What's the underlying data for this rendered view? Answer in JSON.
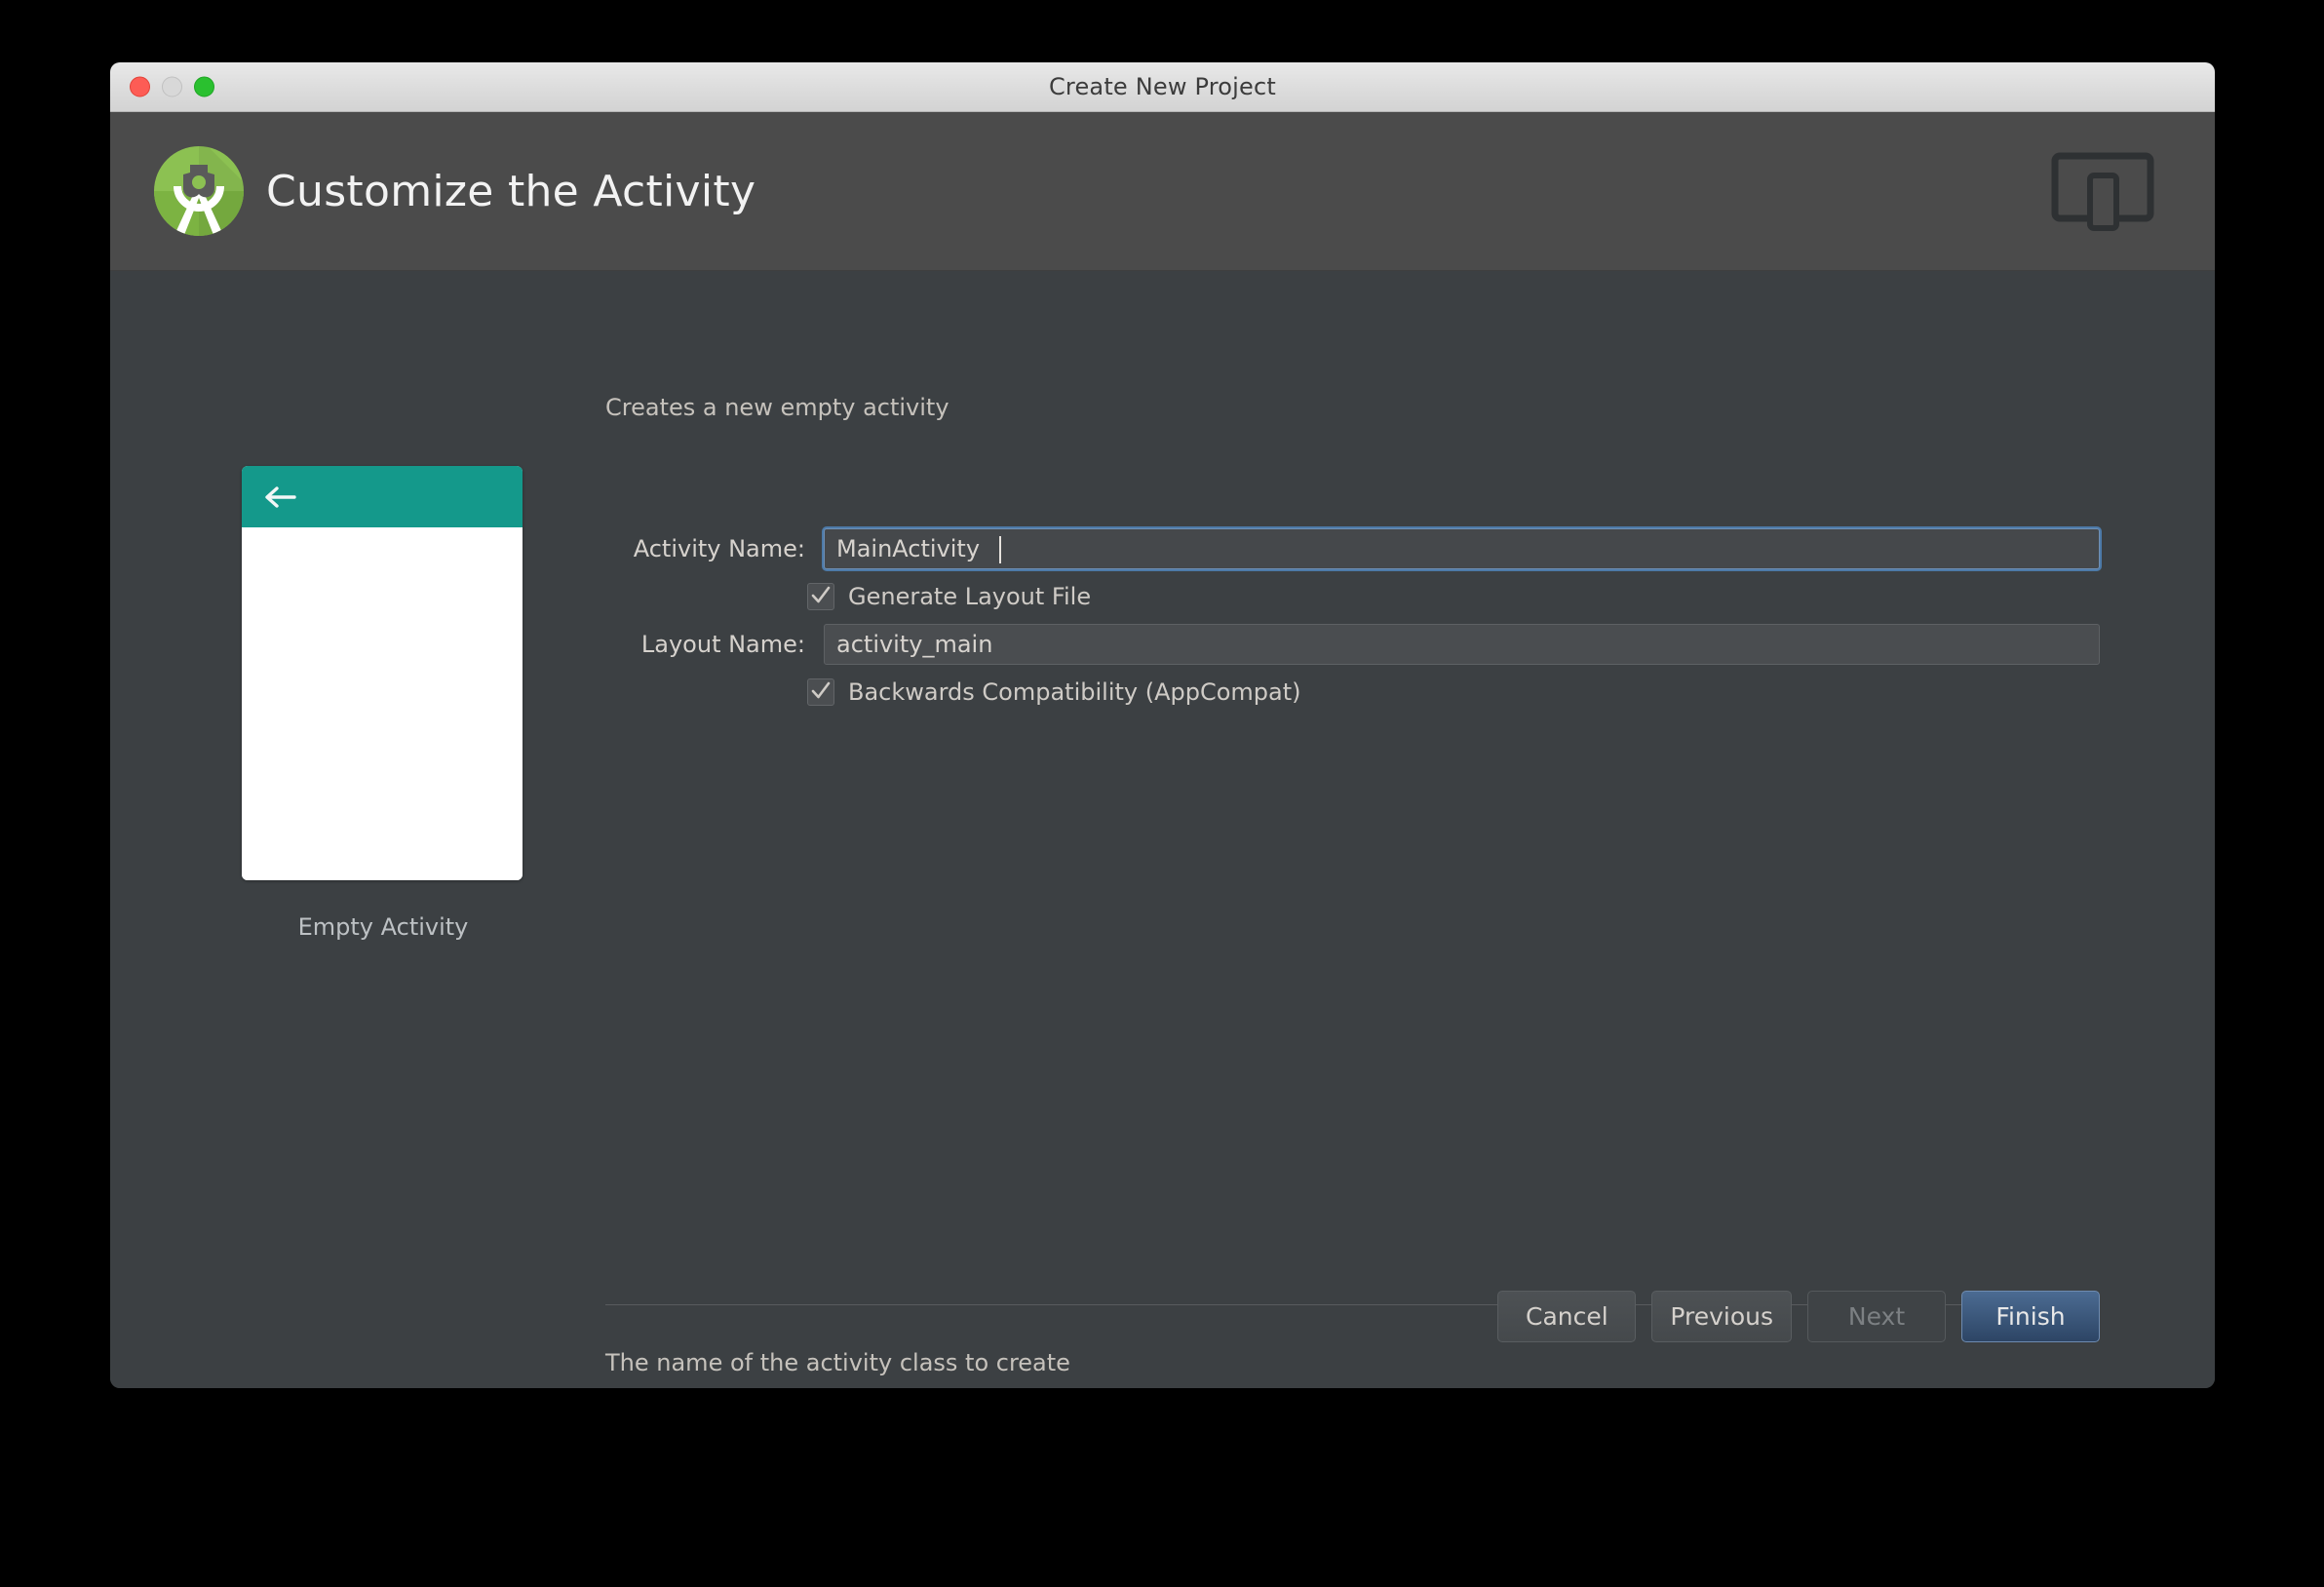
{
  "window": {
    "title": "Create New Project",
    "traffic_lights": [
      "close",
      "minimize",
      "zoom"
    ]
  },
  "header": {
    "title": "Customize the Activity",
    "logo_icon": "android-studio-logo-icon",
    "form_factor_icon": "device-form-factor-icon",
    "accent_green": "#8bc34a"
  },
  "preview": {
    "appbar_color": "#14998b",
    "back_icon": "back-arrow-icon",
    "caption": "Empty Activity"
  },
  "form": {
    "description": "Creates a new empty activity",
    "fields": [
      {
        "label": "Activity Name:",
        "value": "MainActivity",
        "placeholder": "Activity Name",
        "focused": true
      },
      {
        "label": "Layout Name:",
        "value": "activity_main",
        "placeholder": "Layout Name",
        "focused": false
      }
    ],
    "checkboxes": [
      {
        "label": "Generate Layout File",
        "checked": true
      },
      {
        "label": "Backwards Compatibility (AppCompat)",
        "checked": true
      }
    ],
    "help_text": "The name of the activity class to create"
  },
  "buttons": {
    "cancel": "Cancel",
    "previous": "Previous",
    "next": "Next",
    "finish": "Finish",
    "finish_color": "#3b5a80"
  }
}
